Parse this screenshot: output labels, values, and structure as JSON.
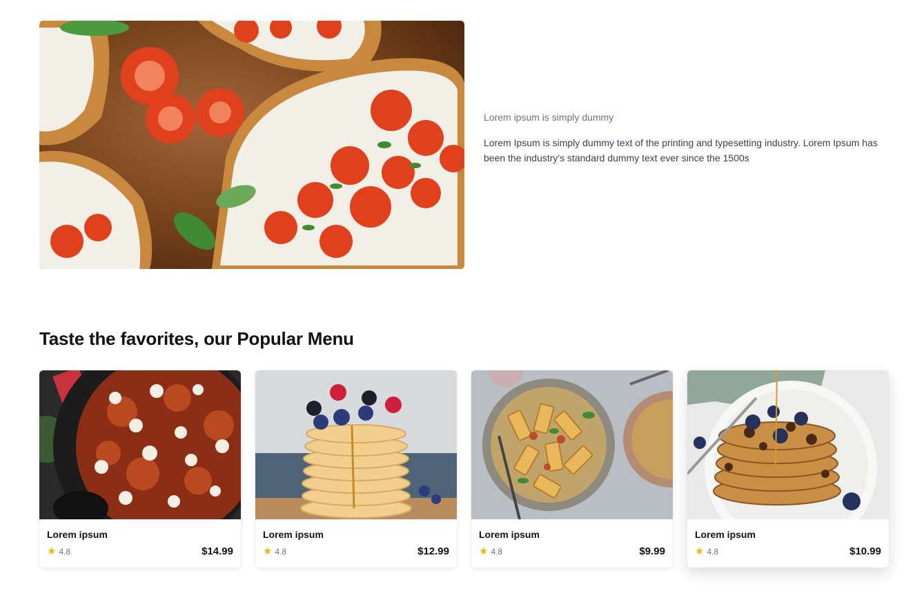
{
  "hero": {
    "image_alt": "bruschetta with tomatoes, basil and ricotta",
    "subtitle": "Lorem ipsum is simply dummy",
    "description": "Lorem Ipsum is simply dummy text of the printing and typesetting industry. Lorem Ipsum has been the industry's standard dummy text ever since the 1500s"
  },
  "popular": {
    "title": "Taste the favorites, our Popular Menu",
    "items": [
      {
        "name": "Lorem ipsum",
        "rating": "4.8",
        "price": "$14.99",
        "image": "baked ravioli skillet",
        "star_icon": "star-icon"
      },
      {
        "name": "Lorem ipsum",
        "rating": "4.8",
        "price": "$12.99",
        "image": "pancake stack with berries",
        "star_icon": "star-icon"
      },
      {
        "name": "Lorem ipsum",
        "rating": "4.8",
        "price": "$9.99",
        "image": "rigatoni pasta bowl",
        "star_icon": "star-icon"
      },
      {
        "name": "Lorem ipsum",
        "rating": "4.8",
        "price": "$10.99",
        "image": "blueberry chocolate pancakes",
        "star_icon": "star-icon"
      }
    ]
  },
  "colors": {
    "star": "#f5b400",
    "text_muted": "#6b7280",
    "heading": "#111111"
  }
}
